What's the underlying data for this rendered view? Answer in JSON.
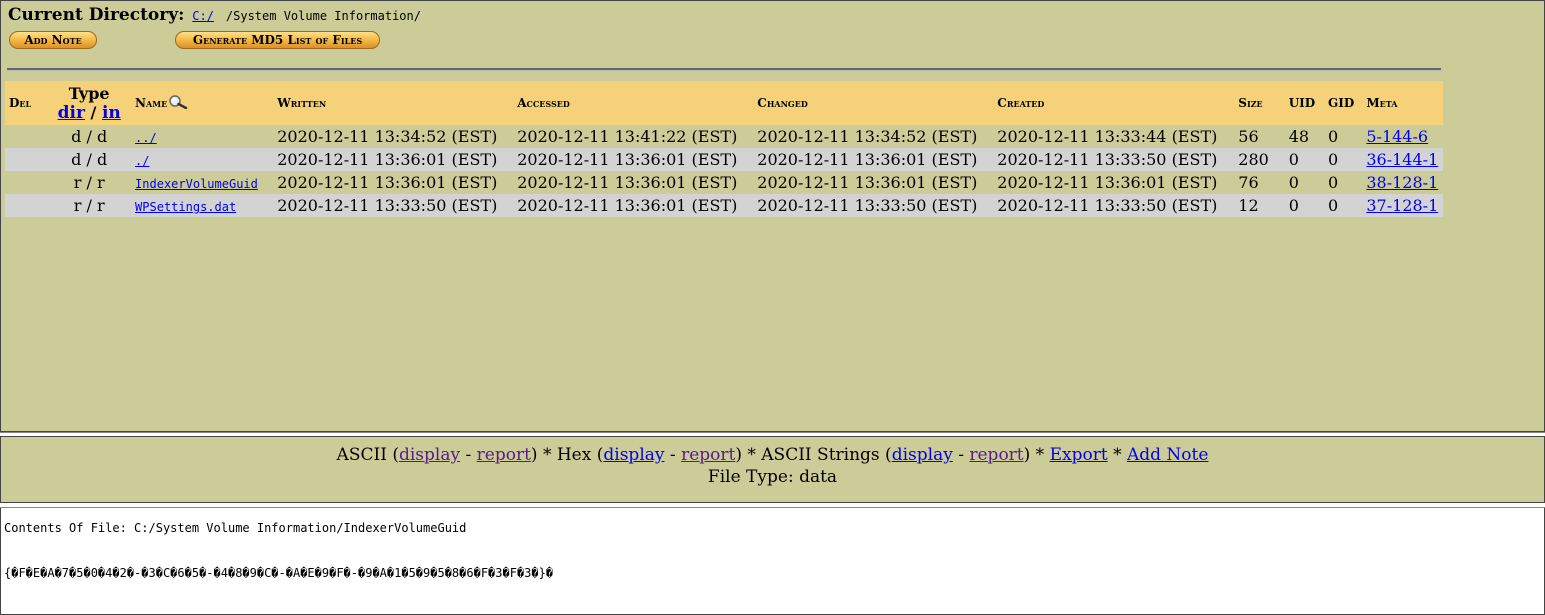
{
  "header": {
    "label": "Current Directory:",
    "root_link": "C:/",
    "path": "/System Volume Information/"
  },
  "buttons": {
    "add_note": "Add Note",
    "md5": "Generate MD5 List of Files"
  },
  "table": {
    "headers": {
      "del": "Del",
      "type": "Type",
      "type_dir": "dir",
      "type_sep": "/",
      "type_in": "in",
      "name": "Name",
      "written": "Written",
      "accessed": "Accessed",
      "changed": "Changed",
      "created": "Created",
      "size": "Size",
      "uid": "UID",
      "gid": "GID",
      "meta": "Meta"
    },
    "rows": [
      {
        "del": "",
        "type": "d / d",
        "name": "../",
        "written": "2020-12-11 13:34:52 (EST)",
        "accessed": "2020-12-11 13:41:22 (EST)",
        "changed": "2020-12-11 13:34:52 (EST)",
        "created": "2020-12-11 13:33:44 (EST)",
        "size": "56",
        "uid": "48",
        "gid": "0",
        "meta": "5-144-6"
      },
      {
        "del": "",
        "type": "d / d",
        "name": "./",
        "written": "2020-12-11 13:36:01 (EST)",
        "accessed": "2020-12-11 13:36:01 (EST)",
        "changed": "2020-12-11 13:36:01 (EST)",
        "created": "2020-12-11 13:33:50 (EST)",
        "size": "280",
        "uid": "0",
        "gid": "0",
        "meta": "36-144-1"
      },
      {
        "del": "",
        "type": "r / r",
        "name": "IndexerVolumeGuid",
        "written": "2020-12-11 13:36:01 (EST)",
        "accessed": "2020-12-11 13:36:01 (EST)",
        "changed": "2020-12-11 13:36:01 (EST)",
        "created": "2020-12-11 13:36:01 (EST)",
        "size": "76",
        "uid": "0",
        "gid": "0",
        "meta": "38-128-1"
      },
      {
        "del": "",
        "type": "r / r",
        "name": "WPSettings.dat",
        "written": "2020-12-11 13:33:50 (EST)",
        "accessed": "2020-12-11 13:36:01 (EST)",
        "changed": "2020-12-11 13:33:50 (EST)",
        "created": "2020-12-11 13:33:50 (EST)",
        "size": "12",
        "uid": "0",
        "gid": "0",
        "meta": "37-128-1"
      }
    ]
  },
  "view": {
    "ascii": "ASCII",
    "hex": "Hex",
    "ascii_strings": "ASCII Strings",
    "display": "display",
    "report": "report",
    "export": "Export",
    "add_note": "Add Note",
    "file_type": "File Type: data"
  },
  "contents": {
    "title": "Contents Of File: C:/System Volume Information/IndexerVolumeGuid",
    "body": "{�F�E�A�7�5�0�4�2�-�3�C�6�5�-�4�8�9�C�-�A�E�9�F�-�9�A�1�5�9�5�8�6�F�3�F�3�}�"
  },
  "colors": {
    "frame_bg": "#cccc99",
    "header_bg": "#f5d27a",
    "alt_row_bg": "#d3d3d3",
    "link": "#0000ee",
    "visited_link": "#551a8b"
  }
}
